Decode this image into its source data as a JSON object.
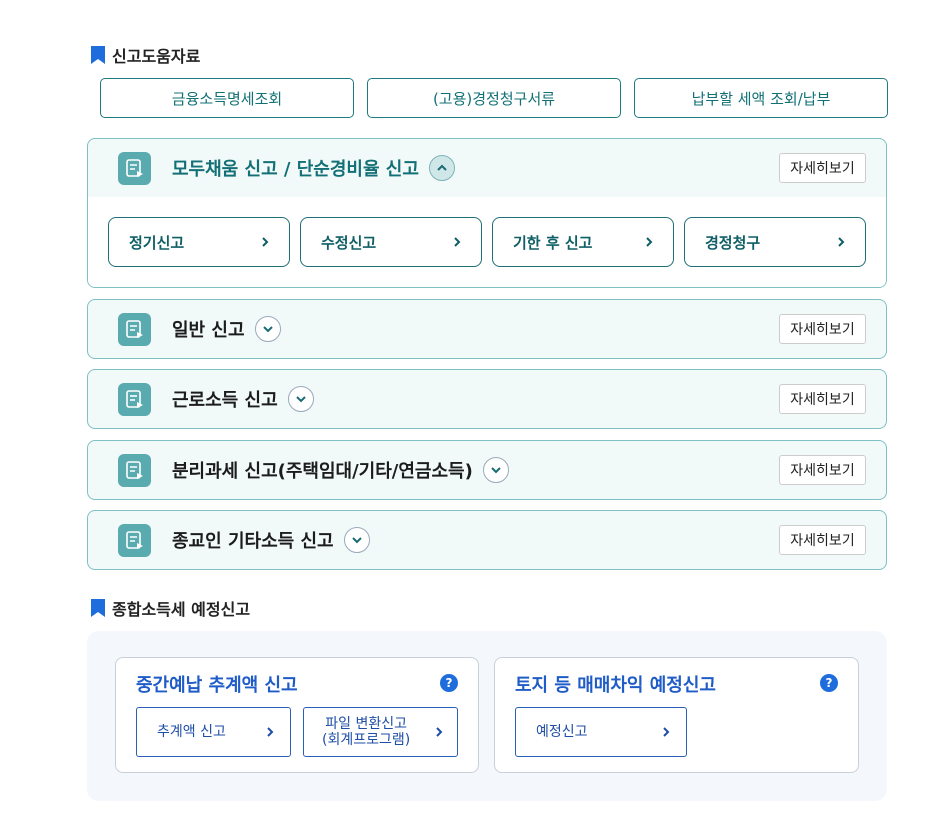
{
  "help_section": {
    "title": "신고도움자료",
    "buttons": [
      "금융소득명세조회",
      "(고용)경정청구서류",
      "납부할 세액 조회/납부"
    ]
  },
  "accordions": [
    {
      "title": "모두채움 신고 / 단순경비율 신고",
      "expanded": true,
      "detail_label": "자세히보기",
      "sub_buttons": [
        "정기신고",
        "수정신고",
        "기한 후 신고",
        "경정청구"
      ]
    },
    {
      "title": "일반 신고",
      "expanded": false,
      "detail_label": "자세히보기"
    },
    {
      "title": "근로소득 신고",
      "expanded": false,
      "detail_label": "자세히보기"
    },
    {
      "title": "분리과세 신고(주택임대/기타/연금소득)",
      "expanded": false,
      "detail_label": "자세히보기"
    },
    {
      "title": "종교인 기타소득 신고",
      "expanded": false,
      "detail_label": "자세히보기"
    }
  ],
  "estimate_section": {
    "title": "종합소득세 예정신고",
    "cards": [
      {
        "title": "중간예납 추계액 신고",
        "help_glyph": "?",
        "buttons": [
          {
            "line1": "추계액 신고",
            "line2": ""
          },
          {
            "line1": "파일 변환신고",
            "line2": "(회계프로그램)"
          }
        ]
      },
      {
        "title": "토지 등 매매차익 예정신고",
        "help_glyph": "?",
        "buttons": [
          {
            "line1": "예정신고",
            "line2": ""
          }
        ]
      }
    ]
  },
  "colors": {
    "teal_border": "#7fc0c4",
    "teal_text": "#127076",
    "icon_bg": "#5aabaf",
    "blue_accent": "#1f5cc7",
    "bookmark_blue": "#1f6cdc"
  }
}
